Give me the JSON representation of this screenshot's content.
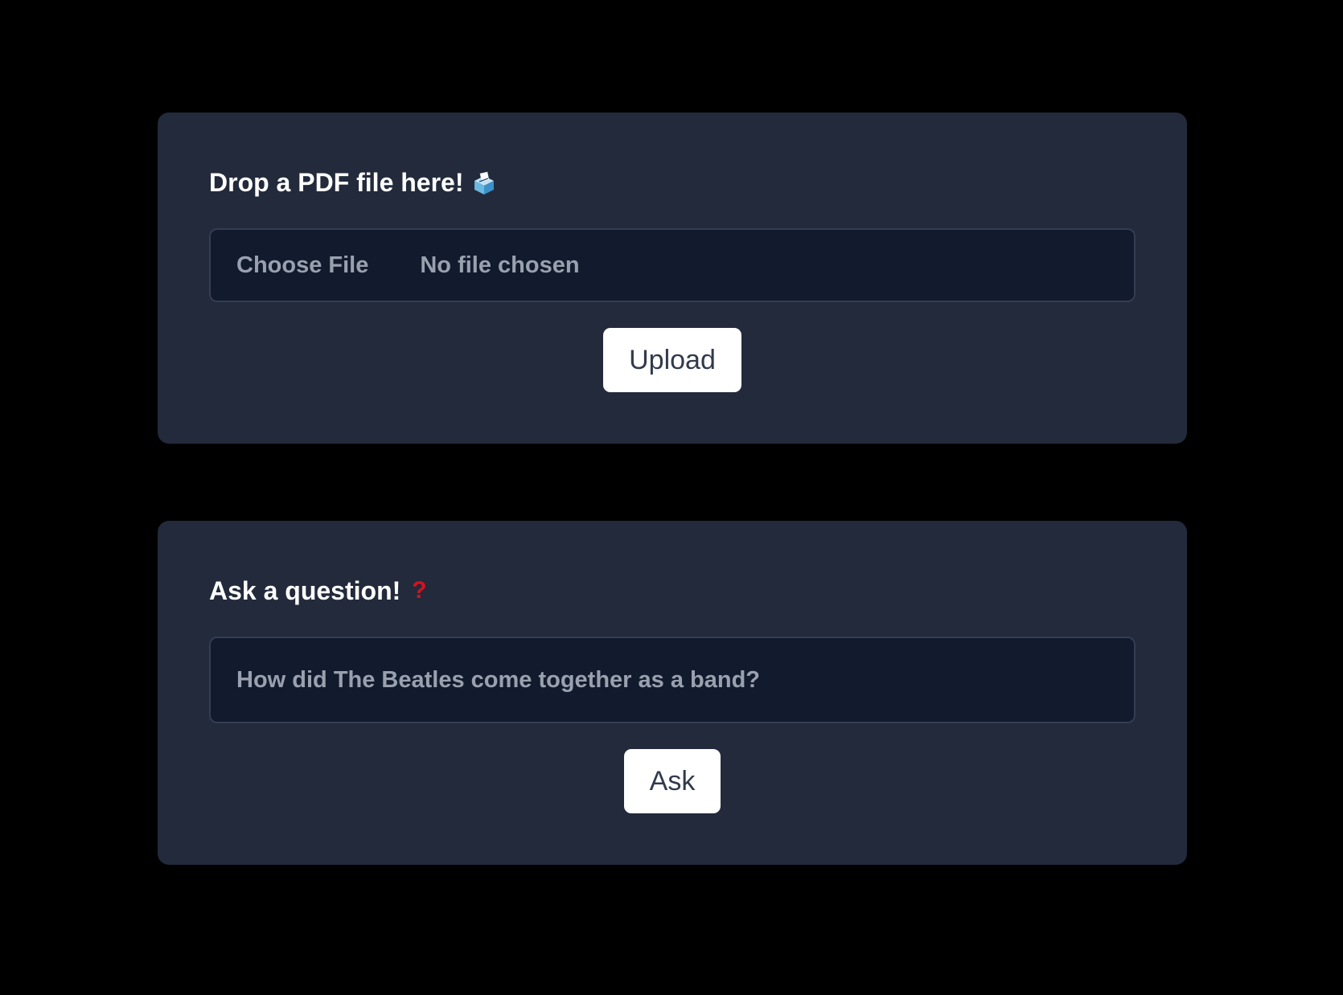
{
  "upload_panel": {
    "title": "Drop a PDF file here!",
    "title_icon": "ballot-box-icon",
    "file_button_label": "Choose File",
    "file_status": "No file chosen",
    "upload_label": "Upload"
  },
  "question_panel": {
    "title": "Ask a question!",
    "title_icon": "question-mark-icon",
    "title_icon_glyph": "?",
    "input_placeholder": "How did The Beatles come together as a band?",
    "ask_label": "Ask"
  },
  "colors": {
    "page_background": "#000000",
    "card_background": "#222a3b",
    "field_background": "#121a2e",
    "button_background": "#ffffff",
    "question_icon": "#d6121f"
  }
}
